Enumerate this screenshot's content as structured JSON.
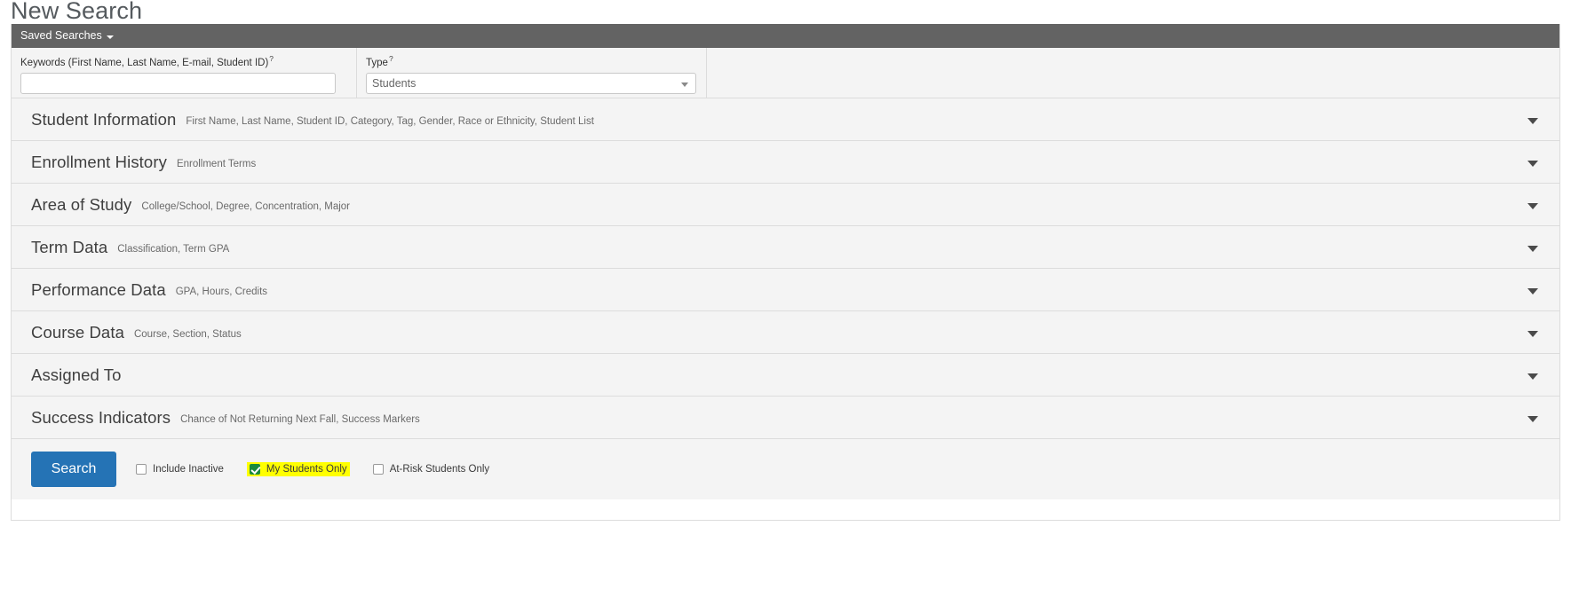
{
  "page": {
    "title": "New Search"
  },
  "toolbar": {
    "saved_searches_label": "Saved Searches"
  },
  "criteria": {
    "keywords": {
      "label": "Keywords (First Name, Last Name, E-mail, Student ID)",
      "help": "?",
      "value": "",
      "placeholder": ""
    },
    "type": {
      "label": "Type",
      "help": "?",
      "selected": "Students"
    }
  },
  "sections": [
    {
      "title": "Student Information",
      "subtitle": "First Name, Last Name, Student ID, Category, Tag, Gender, Race or Ethnicity, Student List"
    },
    {
      "title": "Enrollment History",
      "subtitle": "Enrollment Terms"
    },
    {
      "title": "Area of Study",
      "subtitle": "College/School, Degree, Concentration, Major"
    },
    {
      "title": "Term Data",
      "subtitle": "Classification, Term GPA"
    },
    {
      "title": "Performance Data",
      "subtitle": "GPA, Hours, Credits"
    },
    {
      "title": "Course Data",
      "subtitle": "Course, Section, Status"
    },
    {
      "title": "Assigned To",
      "subtitle": ""
    },
    {
      "title": "Success Indicators",
      "subtitle": "Chance of Not Returning Next Fall, Success Markers"
    }
  ],
  "footer": {
    "search_label": "Search",
    "checkboxes": [
      {
        "label": "Include Inactive",
        "checked": false,
        "highlighted": false
      },
      {
        "label": "My Students Only",
        "checked": true,
        "highlighted": true
      },
      {
        "label": "At-Risk Students Only",
        "checked": false,
        "highlighted": false
      }
    ]
  },
  "colors": {
    "toolbar_bg": "#636363",
    "section_bg": "#f4f4f4",
    "primary_button": "#2573b5",
    "checked_green": "#1a8a3c",
    "highlight_yellow": "#ffff00"
  }
}
